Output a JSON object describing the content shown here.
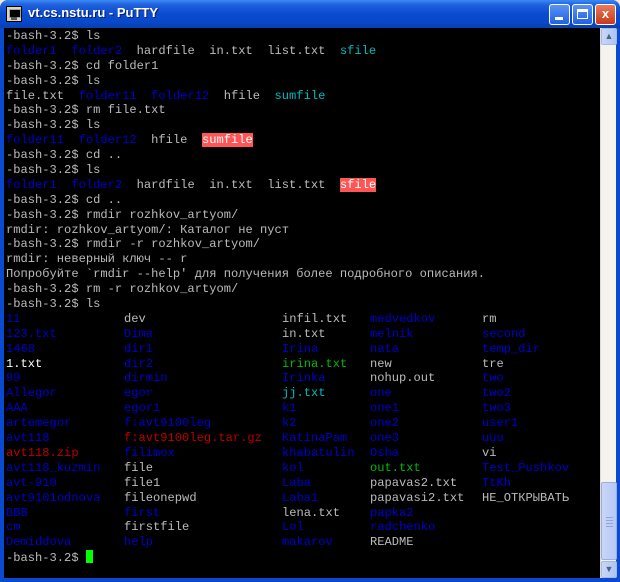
{
  "window": {
    "title": "vt.cs.nstu.ru - PuTTY",
    "buttons": {
      "minimize": "minimize",
      "maximize": "maximize",
      "close": "x"
    }
  },
  "terminal": {
    "prompt": "-bash-3.2$",
    "colors": {
      "dir": "#0000cc",
      "link": "#00bbbb",
      "exec": "#00bb00",
      "archive": "#bb0000",
      "highlight": "#ff5555",
      "cursor": "#00ff00"
    },
    "lines": [
      [
        {
          "t": "-bash-3.2$ ls"
        }
      ],
      [
        {
          "t": "folder1",
          "c": "blue"
        },
        {
          "t": "  "
        },
        {
          "t": "folder2",
          "c": "blue"
        },
        {
          "t": "  hardfile  in.txt  list.txt  "
        },
        {
          "t": "sfile",
          "c": "cyan"
        }
      ],
      [
        {
          "t": "-bash-3.2$ cd folder1"
        }
      ],
      [
        {
          "t": "-bash-3.2$ ls"
        }
      ],
      [
        {
          "t": "file.txt  "
        },
        {
          "t": "folder11",
          "c": "blue"
        },
        {
          "t": "  "
        },
        {
          "t": "folder12",
          "c": "blue"
        },
        {
          "t": "  hfile  "
        },
        {
          "t": "sumfile",
          "c": "cyan"
        }
      ],
      [
        {
          "t": "-bash-3.2$ rm file.txt"
        }
      ],
      [
        {
          "t": "-bash-3.2$ ls"
        }
      ],
      [
        {
          "t": "folder11",
          "c": "blue"
        },
        {
          "t": "  "
        },
        {
          "t": "folder12",
          "c": "blue"
        },
        {
          "t": "  hfile  "
        },
        {
          "t": "sumfile",
          "c": "hl"
        }
      ],
      [
        {
          "t": "-bash-3.2$ cd .."
        }
      ],
      [
        {
          "t": "-bash-3.2$ ls"
        }
      ],
      [
        {
          "t": "folder1",
          "c": "blue"
        },
        {
          "t": "  "
        },
        {
          "t": "folder2",
          "c": "blue"
        },
        {
          "t": "  hardfile  in.txt  list.txt  "
        },
        {
          "t": "sfile",
          "c": "hl"
        }
      ],
      [
        {
          "t": "-bash-3.2$ cd .."
        }
      ],
      [
        {
          "t": "-bash-3.2$ rmdir rozhkov_artyom/"
        }
      ],
      [
        {
          "t": "rmdir: rozhkov_artyom/: Каталог не пуст"
        }
      ],
      [
        {
          "t": "-bash-3.2$ rmdir -r rozhkov_artyom/"
        }
      ],
      [
        {
          "t": "rmdir: неверный ключ -- r"
        }
      ],
      [
        {
          "t": "Попробуйте `rmdir --help' для получения более подробного описания."
        }
      ],
      [
        {
          "t": "-bash-3.2$ rm -r rozhkov_artyom/"
        }
      ],
      [
        {
          "t": "-bash-3.2$ ls"
        }
      ]
    ],
    "listing": [
      [
        {
          "t": "11",
          "c": "blue"
        },
        {
          "t": "dev"
        },
        {
          "t": "infil.txt"
        },
        {
          "t": "medvedkov",
          "c": "blue"
        },
        {
          "t": "rm"
        }
      ],
      [
        {
          "t": "123.txt",
          "c": "blue"
        },
        {
          "t": "Dima",
          "c": "blue"
        },
        {
          "t": "in.txt"
        },
        {
          "t": "melnik",
          "c": "blue"
        },
        {
          "t": "second",
          "c": "blue"
        }
      ],
      [
        {
          "t": "1468",
          "c": "blue"
        },
        {
          "t": "dir1",
          "c": "blue"
        },
        {
          "t": "Irina",
          "c": "blue"
        },
        {
          "t": "nata",
          "c": "blue"
        },
        {
          "t": "temp_dir",
          "c": "blue"
        }
      ],
      [
        {
          "t": "1.txt",
          "c": "white"
        },
        {
          "t": "dir2",
          "c": "blue"
        },
        {
          "t": "irina.txt",
          "c": "green"
        },
        {
          "t": "new"
        },
        {
          "t": "tre"
        }
      ],
      [
        {
          "t": "99",
          "c": "blue"
        },
        {
          "t": "dirmin",
          "c": "blue"
        },
        {
          "t": "Irinka",
          "c": "blue"
        },
        {
          "t": "nohup.out"
        },
        {
          "t": "two",
          "c": "blue"
        }
      ],
      [
        {
          "t": "Allegor",
          "c": "blue"
        },
        {
          "t": "egor",
          "c": "blue"
        },
        {
          "t": "jj.txt",
          "c": "cyan"
        },
        {
          "t": "one",
          "c": "blue"
        },
        {
          "t": "two2",
          "c": "blue"
        }
      ],
      [
        {
          "t": "AAA",
          "c": "blue"
        },
        {
          "t": "egor1",
          "c": "blue"
        },
        {
          "t": "k1",
          "c": "blue"
        },
        {
          "t": "one1",
          "c": "blue"
        },
        {
          "t": "two3",
          "c": "blue"
        }
      ],
      [
        {
          "t": "artemegor",
          "c": "blue"
        },
        {
          "t": "f:avt9100leg",
          "c": "blue"
        },
        {
          "t": "k2",
          "c": "blue"
        },
        {
          "t": "one2",
          "c": "blue"
        },
        {
          "t": "user1",
          "c": "blue"
        }
      ],
      [
        {
          "t": "avt118",
          "c": "blue"
        },
        {
          "t": "f:avt9100leg.tar.gz",
          "c": "red"
        },
        {
          "t": "KatinaPam",
          "c": "blue"
        },
        {
          "t": "one3",
          "c": "blue"
        },
        {
          "t": "uuu",
          "c": "blue"
        }
      ],
      [
        {
          "t": "avt118.zip",
          "c": "red"
        },
        {
          "t": "filimox",
          "c": "blue"
        },
        {
          "t": "khabatulin",
          "c": "blue"
        },
        {
          "t": "Osha",
          "c": "blue"
        },
        {
          "t": "vi"
        }
      ],
      [
        {
          "t": "avt118_kuzmin",
          "c": "blue"
        },
        {
          "t": "file"
        },
        {
          "t": "kol",
          "c": "blue"
        },
        {
          "t": "out.txt",
          "c": "green"
        },
        {
          "t": "Test_Pushkov",
          "c": "blue"
        }
      ],
      [
        {
          "t": "avt-910",
          "c": "blue"
        },
        {
          "t": "file1"
        },
        {
          "t": "Laba",
          "c": "blue"
        },
        {
          "t": "papavas2.txt"
        },
        {
          "t": "TtKh",
          "c": "blue"
        }
      ],
      [
        {
          "t": "avt9101odnova",
          "c": "blue"
        },
        {
          "t": "fileonepwd"
        },
        {
          "t": "Laba1",
          "c": "blue"
        },
        {
          "t": "papavasi2.txt"
        },
        {
          "t": "НЕ_ОТКРЫВАТЬ"
        }
      ],
      [
        {
          "t": "BBB",
          "c": "blue"
        },
        {
          "t": "first",
          "c": "blue"
        },
        {
          "t": "lena.txt"
        },
        {
          "t": "papka2",
          "c": "blue"
        },
        {
          "t": ""
        }
      ],
      [
        {
          "t": "cm",
          "c": "blue"
        },
        {
          "t": "firstfile"
        },
        {
          "t": "Lol",
          "c": "blue"
        },
        {
          "t": "radchenko",
          "c": "blue"
        },
        {
          "t": ""
        }
      ],
      [
        {
          "t": "Demiddova",
          "c": "blue"
        },
        {
          "t": "help",
          "c": "blue"
        },
        {
          "t": "makarov",
          "c": "blue"
        },
        {
          "t": "README"
        },
        {
          "t": ""
        }
      ]
    ],
    "final_prompt": "-bash-3.2$ "
  }
}
